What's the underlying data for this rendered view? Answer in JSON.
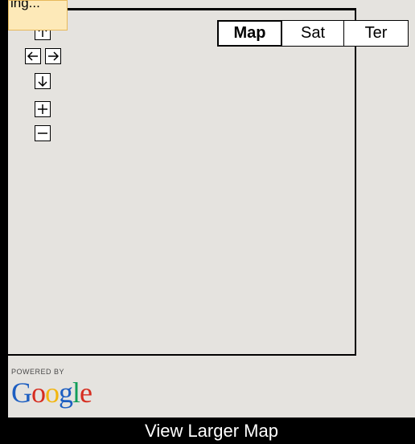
{
  "loading_text": "ing...",
  "map_types": [
    {
      "label": "Map",
      "active": true
    },
    {
      "label": "Sat",
      "active": false
    },
    {
      "label": "Ter",
      "active": false
    }
  ],
  "nav_controls": {
    "pan_up": "pan-up",
    "pan_left": "pan-left",
    "pan_right": "pan-right",
    "pan_down": "pan-down",
    "zoom_in": "zoom-in",
    "zoom_out": "zoom-out"
  },
  "branding": {
    "powered_by": "POWERED BY",
    "logo_letters": [
      "G",
      "o",
      "o",
      "g",
      "l",
      "e"
    ],
    "logo_colors": [
      "#1d5ec1",
      "#d62d20",
      "#f2b50f",
      "#1d5ec1",
      "#109d58",
      "#d62d20"
    ]
  },
  "footer_link": "View Larger Map",
  "colors": {
    "map_background": "#e5e3df",
    "loading_background": "#fde9b8"
  }
}
